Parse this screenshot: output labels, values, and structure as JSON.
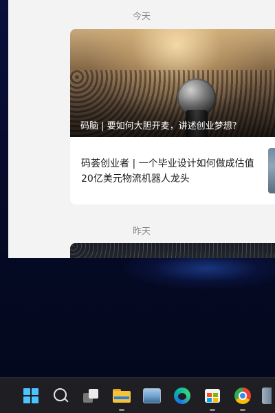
{
  "window": {
    "sections": [
      {
        "date_label": "今天"
      },
      {
        "date_label": "昨天"
      }
    ],
    "featured": {
      "hero_title": "码脑 | 要如何大胆开麦，讲述创业梦想?",
      "article_title": "码荟创业者 | 一个毕业设计如何做成估值20亿美元物流机器人龙头"
    }
  },
  "taskbar": {
    "items": [
      {
        "name": "start-button-icon",
        "running": false
      },
      {
        "name": "search-icon",
        "running": false
      },
      {
        "name": "task-view-icon",
        "running": false
      },
      {
        "name": "file-explorer-icon",
        "running": true
      },
      {
        "name": "photos-icon",
        "running": false
      },
      {
        "name": "edge-icon",
        "running": false
      },
      {
        "name": "microsoft-store-icon",
        "running": true
      },
      {
        "name": "chrome-icon",
        "running": true
      },
      {
        "name": "recycle-bin-icon",
        "running": false
      }
    ]
  },
  "colors": {
    "accent": "#4cc2ff",
    "window_bg": "#f3f3f3",
    "taskbar_bg": "#1f1f23",
    "date_label": "#8a8a8a"
  }
}
